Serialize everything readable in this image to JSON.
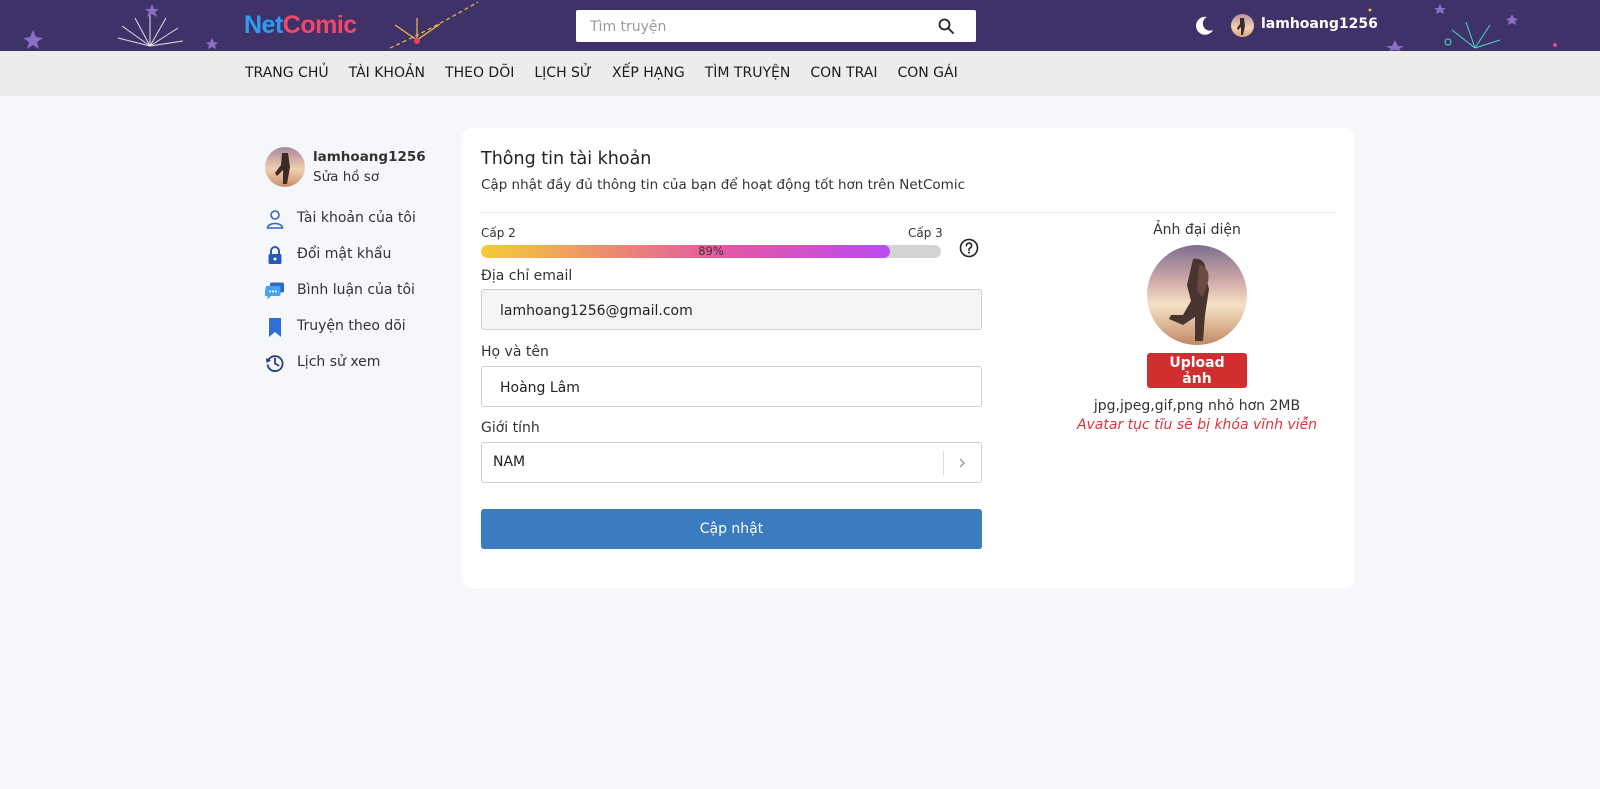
{
  "header": {
    "logo": {
      "part1": "Net",
      "part2": "Comic"
    },
    "search": {
      "placeholder": "Tìm truyện",
      "icon": "search-icon"
    },
    "theme_icon": "moon-icon",
    "username": "lamhoang1256"
  },
  "nav": {
    "items": [
      {
        "label": "TRANG CHỦ"
      },
      {
        "label": "TÀI KHOẢN"
      },
      {
        "label": "THEO DÕI"
      },
      {
        "label": "LỊCH SỬ"
      },
      {
        "label": "XẾP HẠNG"
      },
      {
        "label": "TÌM TRUYỆN"
      },
      {
        "label": "CON TRAI"
      },
      {
        "label": "CON GÁI"
      }
    ]
  },
  "sidebar": {
    "username": "lamhoang1256",
    "edit_profile": "Sửa hồ sơ",
    "items": [
      {
        "label": "Tài khoản của tôi",
        "icon": "user-icon"
      },
      {
        "label": "Đổi mật khẩu",
        "icon": "lock-icon"
      },
      {
        "label": "Bình luận của tôi",
        "icon": "comment-icon"
      },
      {
        "label": "Truyện theo dõi",
        "icon": "bookmark-icon"
      },
      {
        "label": "Lịch sử xem",
        "icon": "history-icon"
      }
    ]
  },
  "account": {
    "title": "Thông tin tài khoản",
    "subtitle": "Cập nhật đầy đủ thông tin của bạn để hoạt động tốt hơn trên NetComic",
    "level_current": "Cấp 2",
    "level_next": "Cấp 3",
    "progress_percent": 89,
    "progress_label": "89%",
    "email_label": "Địa chỉ email",
    "email_value": "lamhoang1256@gmail.com",
    "name_label": "Họ và tên",
    "name_value": "Hoàng Lâm",
    "gender_label": "Giới tính",
    "gender_value": "NAM",
    "update_button": "Cập nhật"
  },
  "avatar": {
    "title": "Ảnh đại diện",
    "upload_button": "Upload ảnh",
    "hint": "jpg,jpeg,gif,png nhỏ hơn 2MB",
    "warning": "Avatar tục tĩu sẽ bị khóa vĩnh viễn"
  },
  "colors": {
    "header_bg": "#3e3268",
    "nav_bg": "#ececec",
    "primary_button": "#3b7bbf",
    "upload_button": "#d12f2f",
    "warning_text": "#e0333a"
  }
}
